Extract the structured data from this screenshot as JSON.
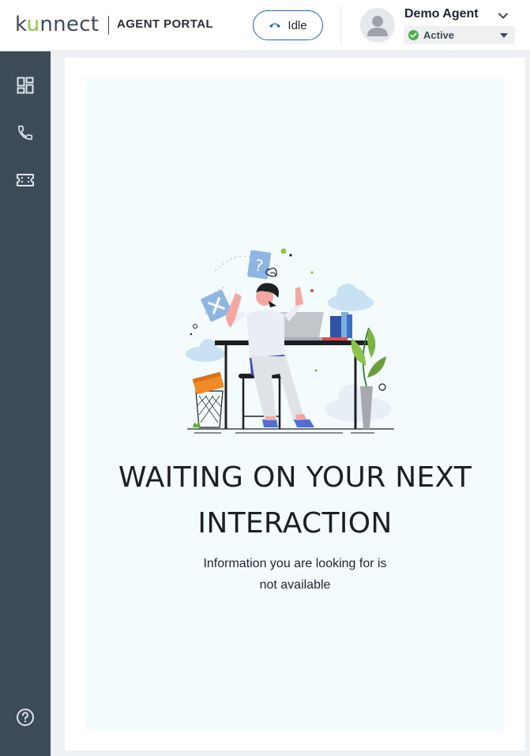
{
  "header": {
    "logo": {
      "prefix": "k",
      "accent": "u",
      "suffix": "nnect"
    },
    "portal_label": "AGENT PORTAL",
    "call_state": {
      "label": "Idle",
      "icon": "phone-hangup-icon"
    },
    "agent": {
      "name": "Demo Agent",
      "status": "Active",
      "status_color": "#4caf50"
    }
  },
  "sidebar": {
    "items": [
      {
        "name": "dashboard",
        "icon": "dashboard-icon"
      },
      {
        "name": "calls",
        "icon": "phone-icon"
      },
      {
        "name": "tickets",
        "icon": "ticket-icon"
      },
      {
        "name": "help",
        "icon": "help-circle-icon"
      }
    ]
  },
  "main": {
    "headline_line1": "WAITING ON YOUR NEXT",
    "headline_line2": "INTERACTION",
    "subtext_line1": "Information you are looking for is",
    "subtext_line2": "not available"
  },
  "colors": {
    "brand_accent": "#8cc63f",
    "primary_blue": "#1e6ab0",
    "sidebar_bg": "#3d4a58",
    "panel_bg": "#f4fbfc"
  }
}
